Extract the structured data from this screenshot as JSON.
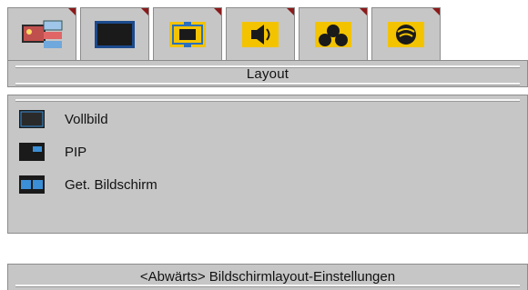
{
  "tabs": [
    {
      "icon": "picture-settings-icon",
      "active": false
    },
    {
      "icon": "screen-icon",
      "active": false
    },
    {
      "icon": "layout-icon",
      "active": true
    },
    {
      "icon": "audio-speaker-icon",
      "active": false
    },
    {
      "icon": "three-circles-icon",
      "active": false
    },
    {
      "icon": "network-globe-icon",
      "active": false
    }
  ],
  "menu": {
    "title": "Layout",
    "options": [
      {
        "label": "Vollbild",
        "icon": "fullscreen-layout-icon"
      },
      {
        "label": "PIP",
        "icon": "pip-layout-icon"
      },
      {
        "label": "Get. Bildschirm",
        "icon": "split-screen-layout-icon"
      }
    ]
  },
  "hint": {
    "text": "<Abwärts> Bildschirmlayout-Einstellungen"
  },
  "colors": {
    "panel_bg": "#c6c6c6",
    "border": "#8c8c8c",
    "tab_corner": "#8b1a1a",
    "icon_yellow": "#f3c300",
    "icon_blue": "#3b8fd6",
    "icon_dark": "#1a1a1a"
  }
}
